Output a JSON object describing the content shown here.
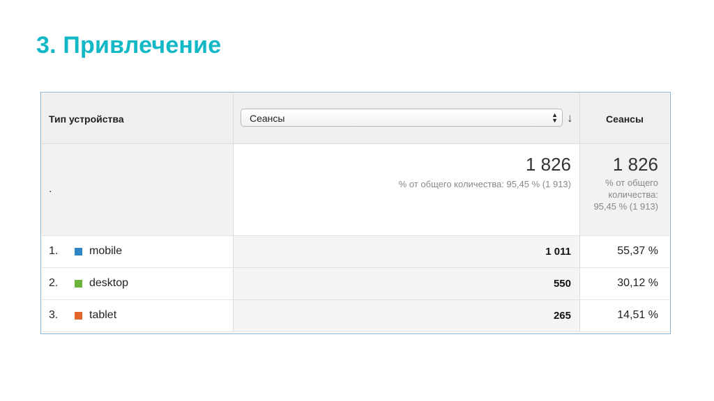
{
  "slide": {
    "title": "3. Привлечение"
  },
  "report": {
    "columns": {
      "dimension": "Тип устройства",
      "metric_select_value": "Сеансы",
      "metric": "Сеансы"
    },
    "totals": {
      "dimension_value": ".",
      "sessions": "1 826",
      "sessions_note": "% от общего количества: 95,45 % (1 913)",
      "share": "1 826",
      "share_note": "% от общего количества: 95,45 % (1 913)"
    },
    "rows": [
      {
        "rank": "1.",
        "device": "mobile",
        "color": "#2f86c7",
        "sessions": "1 011",
        "share": "55,37 %"
      },
      {
        "rank": "2.",
        "device": "desktop",
        "color": "#6cb33e",
        "sessions": "550",
        "share": "30,12 %"
      },
      {
        "rank": "3.",
        "device": "tablet",
        "color": "#e2662a",
        "sessions": "265",
        "share": "14,51 %"
      }
    ]
  },
  "colors": {
    "title": "#12b8c6",
    "frame_border": "#8ab3d8"
  },
  "icons": {
    "select_arrows": "updown-arrows-icon",
    "sort": "sort-down-arrow-icon"
  }
}
